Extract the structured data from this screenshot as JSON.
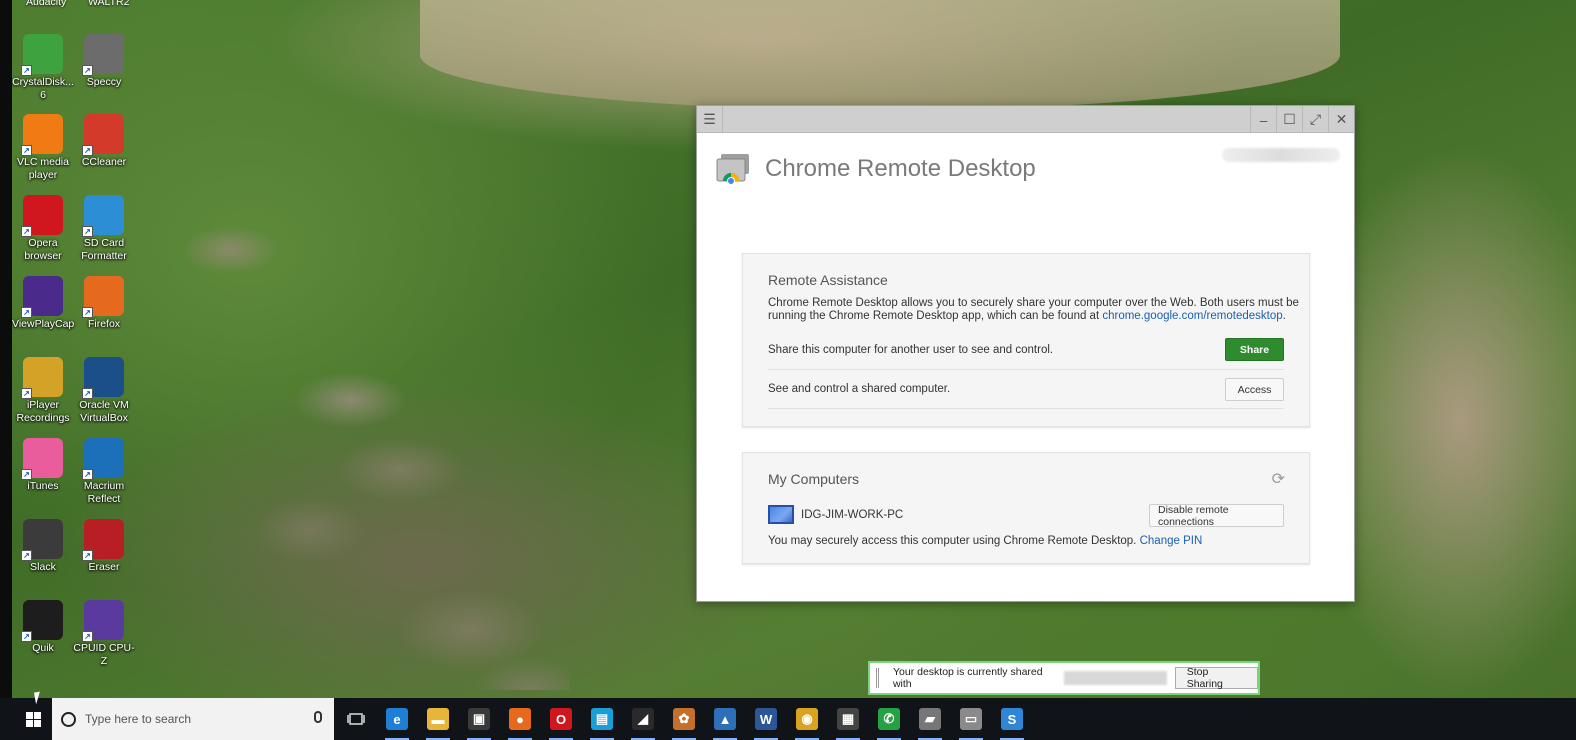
{
  "desktop": {
    "top_partial_labels": [
      "Audacity",
      "WALTR2"
    ],
    "icons": [
      {
        "label": "CrystalDisk... 6",
        "icon": "disk-info-icon",
        "color": "#3ea33e"
      },
      {
        "label": "Speccy",
        "icon": "speccy-icon",
        "color": "#6c6c6c"
      },
      {
        "label": "VLC media player",
        "icon": "vlc-cone-icon",
        "color": "#f07a13"
      },
      {
        "label": "CCleaner",
        "icon": "ccleaner-icon",
        "color": "#d43a2a"
      },
      {
        "label": "Opera browser",
        "icon": "opera-icon",
        "color": "#d0161f"
      },
      {
        "label": "SD Card Formatter",
        "icon": "sd-card-icon",
        "color": "#2c8fd6"
      },
      {
        "label": "ViewPlayCap",
        "icon": "viewplaycap-icon",
        "color": "#4a2a8a"
      },
      {
        "label": "Firefox",
        "icon": "firefox-icon",
        "color": "#e66a1d"
      },
      {
        "label": "iPlayer Recordings",
        "icon": "folder-icon",
        "color": "#d4a227"
      },
      {
        "label": "Oracle VM VirtualBox",
        "icon": "virtualbox-icon",
        "color": "#1b4f8a"
      },
      {
        "label": "iTunes",
        "icon": "itunes-icon",
        "color": "#e95d9c"
      },
      {
        "label": "Macrium Reflect",
        "icon": "macrium-icon",
        "color": "#1c6fb9"
      },
      {
        "label": "Slack",
        "icon": "slack-icon",
        "color": "#3b3b3b"
      },
      {
        "label": "Eraser",
        "icon": "eraser-icon",
        "color": "#b81f24"
      },
      {
        "label": "Quik",
        "icon": "quik-icon",
        "color": "#1d1d1d"
      },
      {
        "label": "CPUID CPU-Z",
        "icon": "cpuz-icon",
        "color": "#5a3a9e"
      }
    ]
  },
  "crd": {
    "title": "Chrome Remote Desktop",
    "remote_assistance": {
      "heading": "Remote Assistance",
      "description_1": "Chrome Remote Desktop allows you to securely share your computer over the Web. Both users must be",
      "description_2": "running the Chrome Remote Desktop app, which can be found at",
      "link": "chrome.google.com/remotedesktop",
      "link_suffix": ".",
      "share_text": "Share this computer for another user to see and control.",
      "share_button": "Share",
      "access_text": "See and control a shared computer.",
      "access_button": "Access"
    },
    "my_computers": {
      "heading": "My Computers",
      "computer_name": "IDG-JIM-WORK-PC",
      "disable_button": "Disable remote connections",
      "pin_text": "You may securely access this computer using Chrome Remote Desktop.",
      "change_pin": "Change PIN"
    }
  },
  "share_bar": {
    "text": "Your desktop is currently shared with",
    "stop_button": "Stop Sharing"
  },
  "taskbar": {
    "search_placeholder": "Type here to search",
    "apps": [
      {
        "name": "edge-icon",
        "glyph": "e",
        "color": "#1e7fd6"
      },
      {
        "name": "file-explorer-icon",
        "glyph": "▬",
        "color": "#e8b53a"
      },
      {
        "name": "store-icon",
        "glyph": "▣",
        "color": "#3a3a3a"
      },
      {
        "name": "firefox-icon",
        "glyph": "●",
        "color": "#e66a1d"
      },
      {
        "name": "opera-icon",
        "glyph": "O",
        "color": "#d0161f"
      },
      {
        "name": "app-window-icon",
        "glyph": "▤",
        "color": "#1b9ed8"
      },
      {
        "name": "notes-icon",
        "glyph": "◢",
        "color": "#2a2a2a"
      },
      {
        "name": "app-orange-icon",
        "glyph": "✿",
        "color": "#c56f2c"
      },
      {
        "name": "linux-arrow-icon",
        "glyph": "▲",
        "color": "#2d6fb8"
      },
      {
        "name": "word-icon",
        "glyph": "W",
        "color": "#2b5797"
      },
      {
        "name": "chrome-icon",
        "glyph": "◉",
        "color": "#d9a321"
      },
      {
        "name": "calculator-icon",
        "glyph": "▦",
        "color": "#444444"
      },
      {
        "name": "whatsapp-icon",
        "glyph": "✆",
        "color": "#25a244"
      },
      {
        "name": "network-icon",
        "glyph": "▰",
        "color": "#777777"
      },
      {
        "name": "remote-desktop-icon",
        "glyph": "▭",
        "color": "#8a8a8a"
      },
      {
        "name": "sketch-s-icon",
        "glyph": "S",
        "color": "#2f86d4"
      }
    ]
  }
}
